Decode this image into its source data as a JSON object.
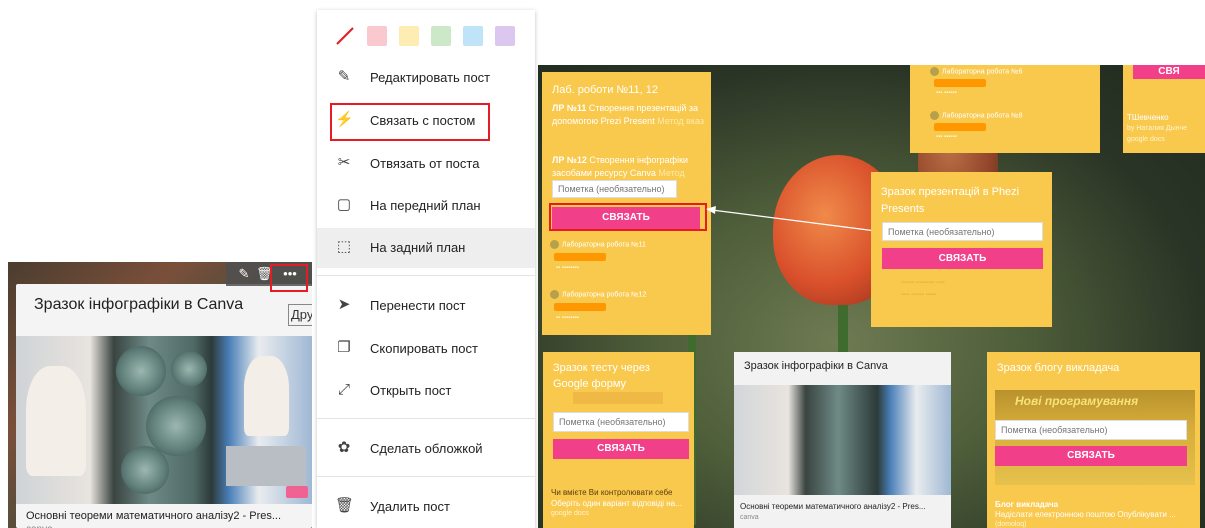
{
  "left": {
    "card_title": "Зразок інфографіки в Canva",
    "link_text": "Основні теореми математичного аналізу2 - Pres...",
    "link_source": "canva",
    "tooltip": "Дру"
  },
  "menu": {
    "swatches": [
      "none",
      "#f9c9cf",
      "#fdedb2",
      "#cde8c9",
      "#bfe3f7",
      "#dcc7ee"
    ],
    "items": [
      {
        "label": "Редактировать пост",
        "icon": "pencil-icon"
      },
      {
        "label": "Связать с постом",
        "icon": "link-posts-icon"
      },
      {
        "label": "Отвязать от поста",
        "icon": "unlink-icon"
      },
      {
        "label": "На передний план",
        "icon": "bring-front-icon"
      },
      {
        "label": "На задний план",
        "icon": "send-back-icon"
      },
      {
        "label": "Перенести пост",
        "icon": "send-icon"
      },
      {
        "label": "Скопировать пост",
        "icon": "copy-icon"
      },
      {
        "label": "Открыть пост",
        "icon": "expand-icon"
      },
      {
        "label": "Сделать обложкой",
        "icon": "cover-icon"
      },
      {
        "label": "Удалить пост",
        "icon": "trash-icon"
      }
    ]
  },
  "board": {
    "lab_card": {
      "title": "Лаб. роботи №11, 12",
      "line1_bold": "ЛР №11",
      "line1_text": " Створення презентацій за допомогою Prezi Present",
      "line1_link": "Метод вказ",
      "line2_bold": "ЛР №12",
      "line2_text": " Створення інфографіки засобами ресурсу Canva",
      "line2_link": "Метод",
      "note_placeholder": "Пометка (необязательно)",
      "connect_label": "СВЯЗАТЬ",
      "item1": "Лабораторна робота №11",
      "item2": "Лабораторна робота №12"
    },
    "top_card": {
      "item1": "Лабораторна робота №6",
      "item2": "Лабораторна робота №8"
    },
    "corner_card": {
      "btn": "СВЯ",
      "author": "ТШевченко",
      "by": "by Наталия Дынче",
      "source": "google docs"
    },
    "prezi_card": {
      "title": "Зразок презентацій в Phezi Presents",
      "note_placeholder": "Пометка (необязательно)",
      "connect_label": "СВЯЗАТЬ"
    },
    "test_card": {
      "title": "Зразок тесту через Google форму",
      "note_placeholder": "Пометка (необязательно)",
      "connect_label": "СВЯЗАТЬ",
      "footer1": "Чи вмієте Ви контролювати себе",
      "footer2": "Оберіть один варіант відповіді на...",
      "footer3": "google docs"
    },
    "canva_card": {
      "title": "Зразок інфографіки в Canva",
      "link_text": "Основні теореми математичного аналізу2 - Pres...",
      "link_source": "canva"
    },
    "blog_card": {
      "title": "Зразок блогу викладача",
      "banner": "Нові програмування",
      "note_placeholder": "Пометка (необязательно)",
      "connect_label": "СВЯЗАТЬ",
      "footer1": "Блог викладача",
      "footer2": "Надіслати електронною поштою Опублікувати ...",
      "footer3": "(domoloq)"
    }
  }
}
